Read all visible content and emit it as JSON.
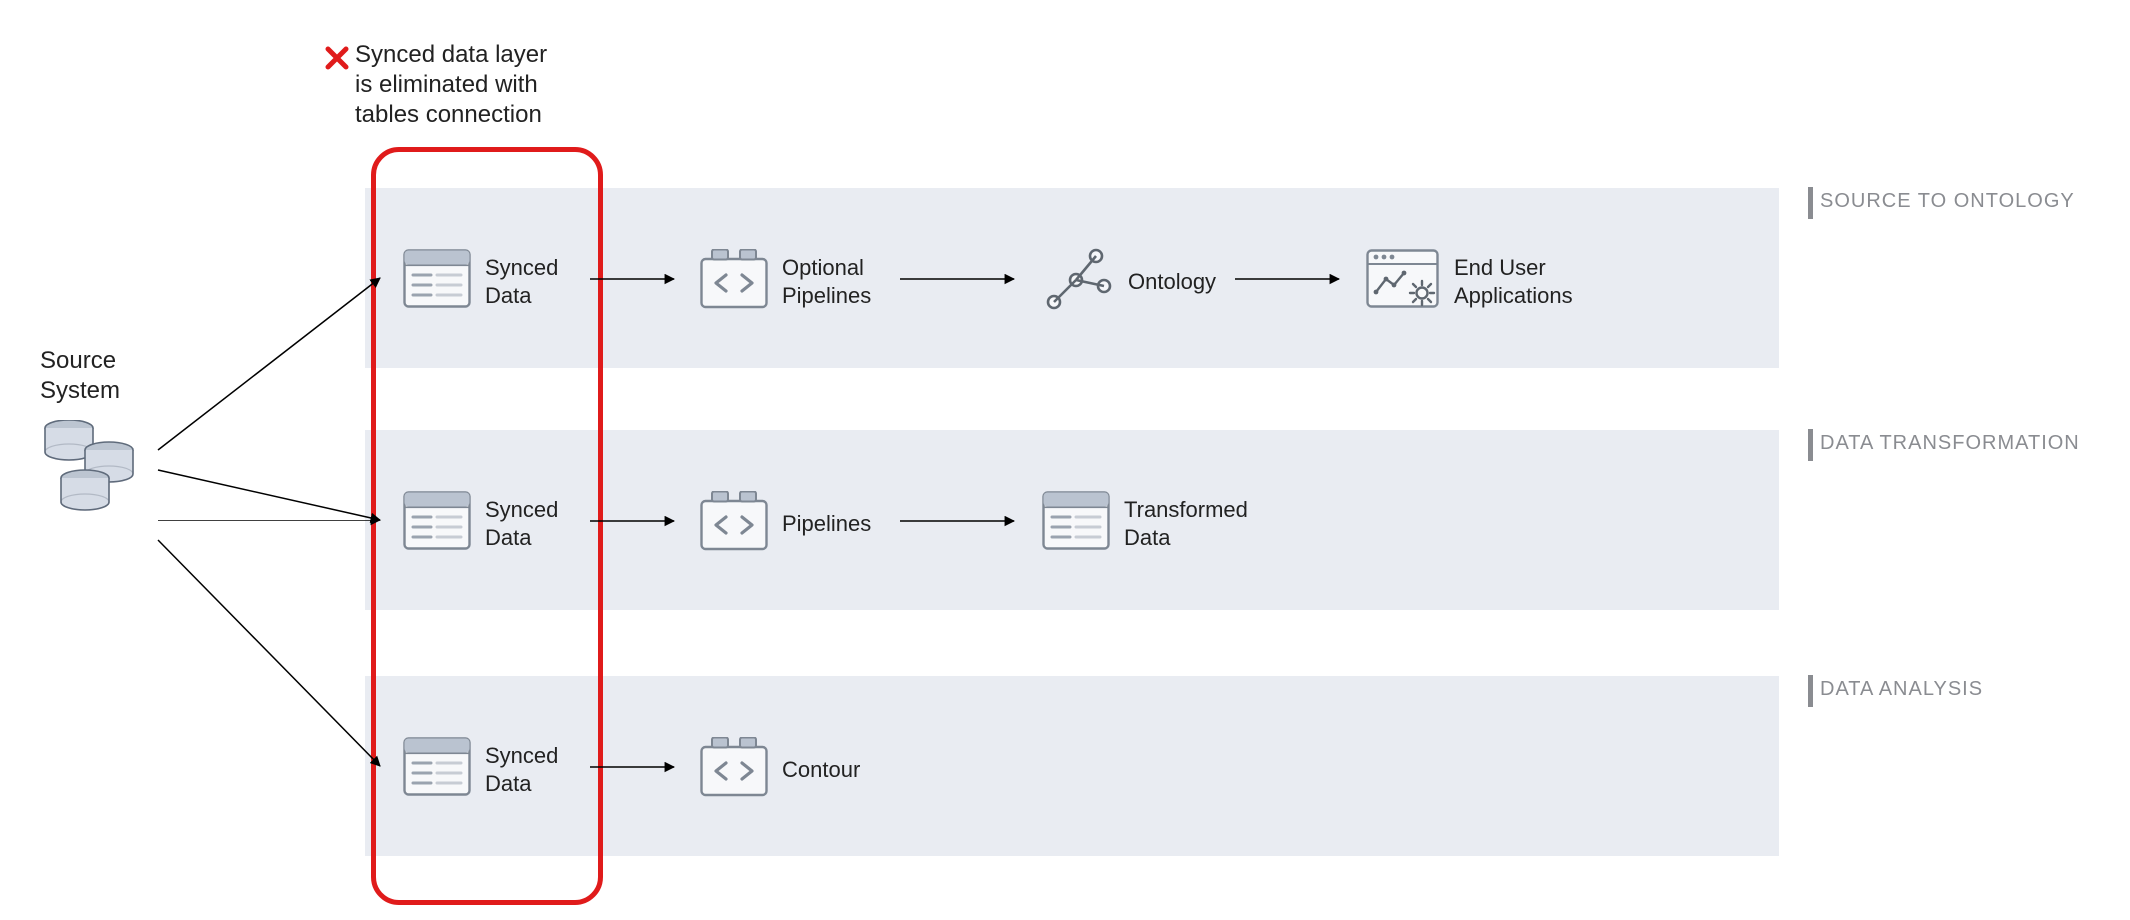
{
  "callout": {
    "text_line1": "Synced data layer",
    "text_line2": "is eliminated with",
    "text_line3": "tables connection"
  },
  "source": {
    "label_line1": "Source",
    "label_line2": "System"
  },
  "lanes": {
    "ontology": {
      "title": "SOURCE TO ONTOLOGY",
      "synced": "Synced",
      "synced2": "Data",
      "pipelines": "Optional",
      "pipelines2": "Pipelines",
      "ontology": "Ontology",
      "apps": "End User",
      "apps2": "Applications"
    },
    "transform": {
      "title": "DATA TRANSFORMATION",
      "synced": "Synced",
      "synced2": "Data",
      "pipelines": "Pipelines",
      "out": "Transformed",
      "out2": "Data"
    },
    "analysis": {
      "title": "DATA ANALYSIS",
      "synced": "Synced",
      "synced2": "Data",
      "contour": "Contour"
    }
  }
}
